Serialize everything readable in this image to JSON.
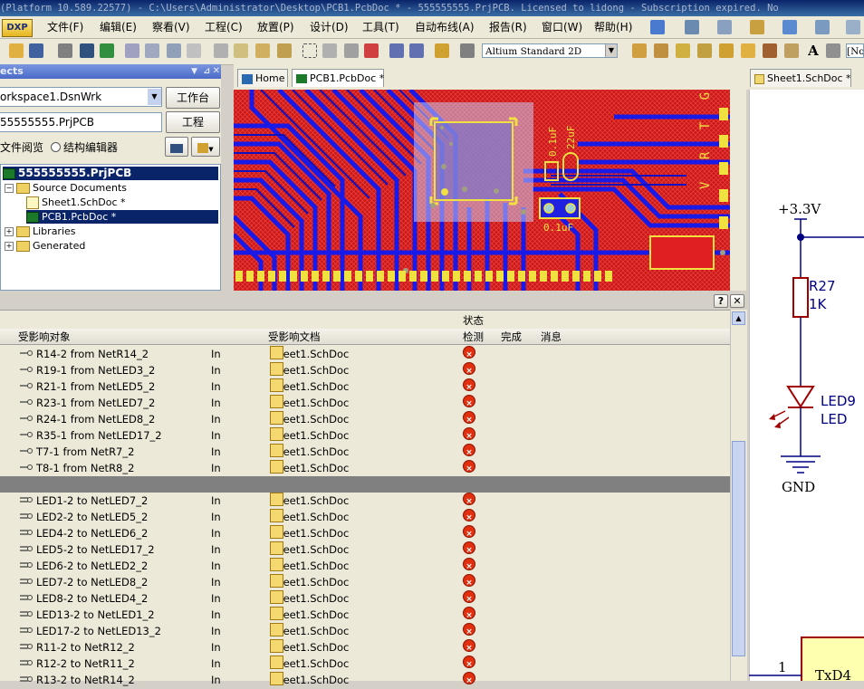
{
  "window": {
    "title": "(Platform 10.589.22577) - C:\\Users\\Administrator\\Desktop\\PCB1.PcbDoc * - 555555555.PrjPCB. Licensed to lidong - Subscription expired. No"
  },
  "menu": {
    "dxp": "DXP",
    "items": [
      "文件(F)",
      "编辑(E)",
      "察看(V)",
      "工程(C)",
      "放置(P)",
      "设计(D)",
      "工具(T)",
      "自动布线(A)",
      "报告(R)",
      "窗口(W)",
      "帮助(H)"
    ]
  },
  "toolbar": {
    "view_combo": "Altium Standard 2D",
    "right_combo": "[No"
  },
  "projects_panel": {
    "title": "ects",
    "workspace": "orkspace1.DsnWrk",
    "workspace_button": "工作台",
    "project": "55555555.PrjPCB",
    "project_button": "工程",
    "radio_file_view": "文件阅览",
    "radio_struct_editor": "结构编辑器",
    "tree": {
      "project": "555555555.PrjPCB",
      "source_documents": "Source Documents",
      "sheet": "Sheet1.SchDoc *",
      "pcb": "PCB1.PcbDoc *",
      "libraries": "Libraries",
      "generated": "Generated"
    }
  },
  "tabs": {
    "home": "Home",
    "pcb": "PCB1.PcbDoc *",
    "sheet": "Sheet1.SchDoc *"
  },
  "pcb_labels": {
    "cap1": "0.1uF",
    "cap2": "22uF",
    "cap3": "0.1uF",
    "letters": "V R T G"
  },
  "messages": {
    "help_button": "?",
    "close_button": "✕",
    "status_header": "状态",
    "columns": {
      "object": "受影响对象",
      "document": "受影响文档",
      "check": "检测",
      "done": "完成",
      "message": "消息"
    },
    "rows_a": [
      {
        "object": "R14-2 from NetR14_2",
        "dir": "In",
        "doc": "Sheet1.SchDoc"
      },
      {
        "object": "R19-1 from NetLED3_2",
        "dir": "In",
        "doc": "Sheet1.SchDoc"
      },
      {
        "object": "R21-1 from NetLED5_2",
        "dir": "In",
        "doc": "Sheet1.SchDoc"
      },
      {
        "object": "R23-1 from NetLED7_2",
        "dir": "In",
        "doc": "Sheet1.SchDoc"
      },
      {
        "object": "R24-1 from NetLED8_2",
        "dir": "In",
        "doc": "Sheet1.SchDoc"
      },
      {
        "object": "R35-1 from NetLED17_2",
        "dir": "In",
        "doc": "Sheet1.SchDoc"
      },
      {
        "object": "T7-1 from NetR7_2",
        "dir": "In",
        "doc": "Sheet1.SchDoc"
      },
      {
        "object": "T8-1 from NetR8_2",
        "dir": "In",
        "doc": "Sheet1.SchDoc"
      }
    ],
    "rows_b": [
      {
        "object": "LED1-2 to NetLED7_2",
        "dir": "In",
        "doc": "Sheet1.SchDoc"
      },
      {
        "object": "LED2-2 to NetLED5_2",
        "dir": "In",
        "doc": "Sheet1.SchDoc"
      },
      {
        "object": "LED4-2 to NetLED6_2",
        "dir": "In",
        "doc": "Sheet1.SchDoc"
      },
      {
        "object": "LED5-2 to NetLED17_2",
        "dir": "In",
        "doc": "Sheet1.SchDoc"
      },
      {
        "object": "LED6-2 to NetLED2_2",
        "dir": "In",
        "doc": "Sheet1.SchDoc"
      },
      {
        "object": "LED7-2 to NetLED8_2",
        "dir": "In",
        "doc": "Sheet1.SchDoc"
      },
      {
        "object": "LED8-2 to NetLED4_2",
        "dir": "In",
        "doc": "Sheet1.SchDoc"
      },
      {
        "object": "LED13-2 to NetLED1_2",
        "dir": "In",
        "doc": "Sheet1.SchDoc"
      },
      {
        "object": "LED17-2 to NetLED13_2",
        "dir": "In",
        "doc": "Sheet1.SchDoc"
      },
      {
        "object": "R11-2 to NetR12_2",
        "dir": "In",
        "doc": "Sheet1.SchDoc"
      },
      {
        "object": "R12-2 to NetR11_2",
        "dir": "In",
        "doc": "Sheet1.SchDoc"
      },
      {
        "object": "R13-2 to NetR14_2",
        "dir": "In",
        "doc": "Sheet1.SchDoc"
      }
    ]
  },
  "schematic": {
    "vcc": "+3.3V",
    "r_name": "R27",
    "r_value": "1K",
    "led_name": "LED9",
    "led_value": "LED",
    "gnd": "GND",
    "pin": "1",
    "block": "TxD4"
  },
  "colors": {
    "pcb_bg": "#d02020",
    "pcb_bottom": "#1818e0",
    "silk": "#f0e040",
    "error": "#e03010"
  }
}
